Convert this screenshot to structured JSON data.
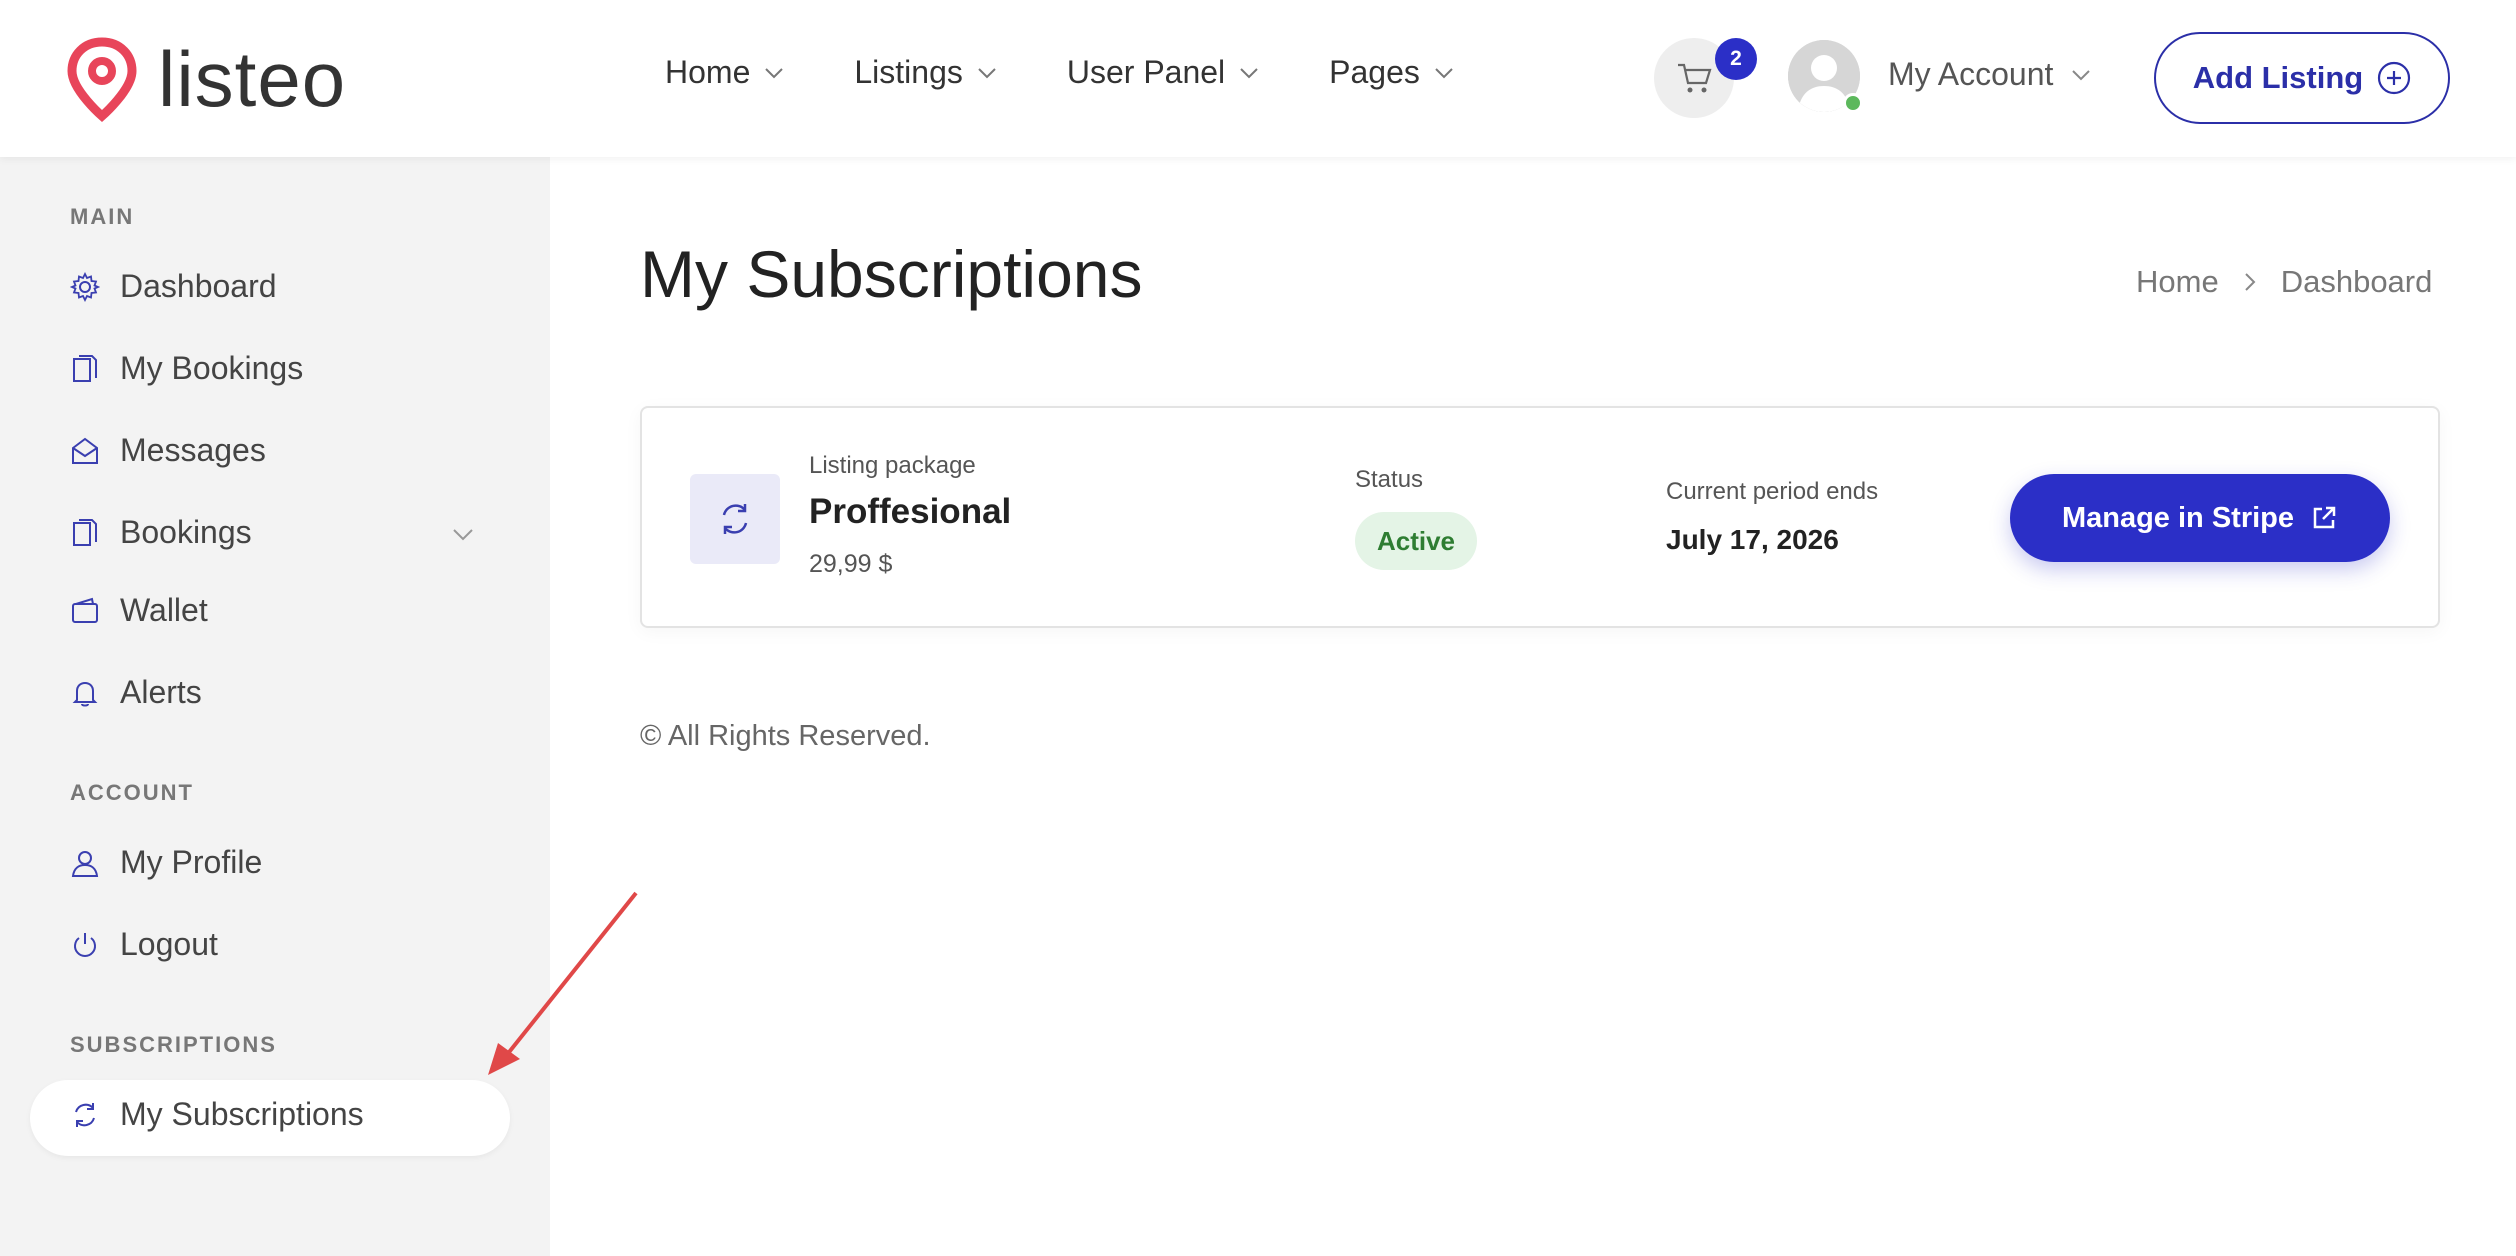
{
  "header": {
    "logo_text": "listeo",
    "nav": [
      {
        "label": "Home"
      },
      {
        "label": "Listings"
      },
      {
        "label": "User Panel"
      },
      {
        "label": "Pages"
      }
    ],
    "cart_count": "2",
    "account_label": "My Account",
    "add_listing_label": "Add Listing"
  },
  "sidebar": {
    "sections": {
      "main": "MAIN",
      "account": "ACCOUNT",
      "subscriptions": "SUBSCRIPTIONS"
    },
    "items": {
      "dashboard": "Dashboard",
      "my_bookings": "My Bookings",
      "messages": "Messages",
      "bookings": "Bookings",
      "wallet": "Wallet",
      "alerts": "Alerts",
      "my_profile": "My Profile",
      "logout": "Logout",
      "my_subscriptions": "My Subscriptions"
    }
  },
  "main": {
    "title": "My Subscriptions",
    "breadcrumb": [
      "Home",
      "Dashboard"
    ],
    "subscription": {
      "package_label": "Listing package",
      "package_name": "Proffesional",
      "price": "29,99 $",
      "status_label": "Status",
      "status_value": "Active",
      "period_label": "Current period ends",
      "period_value": "July 17, 2026",
      "manage_label": "Manage in Stripe"
    },
    "footer": "© All Rights Reserved."
  },
  "colors": {
    "accent": "#2b2fc7",
    "logo": "#e8455a",
    "status_bg": "#e4f4e6",
    "status_text": "#2e7d32",
    "annotation_arrow": "#e04848"
  }
}
